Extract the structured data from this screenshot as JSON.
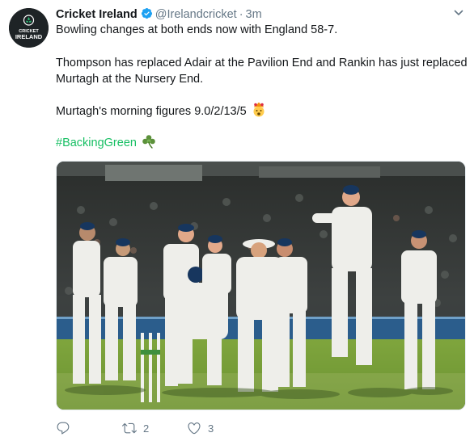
{
  "tweet": {
    "account_name": "Cricket Ireland",
    "handle": "@Irelandcricket",
    "separator": "·",
    "time": "3m",
    "lines": [
      "Bowling changes at both ends now with England 58-7.",
      "Thompson has replaced Adair at the Pavilion End and Rankin has just replaced",
      "Murtagh at the Nursery End.",
      "Murtagh's morning figures 9.0/2/13/5"
    ],
    "hashtag": "#BackingGreen",
    "avatar_text": [
      "CRICKET",
      "IRELAND"
    ],
    "accent_color": "#17bf63",
    "verified_color": "#1da1f2",
    "photo_alt": "Ireland players celebrating a wicket at Lord's"
  },
  "actions": {
    "reply_count": "",
    "retweet_count": "2",
    "like_count": "3"
  },
  "icons": [
    "verified-icon",
    "caret-down-icon",
    "shamrock-icon",
    "exploding-head-emoji",
    "reply-icon",
    "retweet-icon",
    "like-icon"
  ]
}
